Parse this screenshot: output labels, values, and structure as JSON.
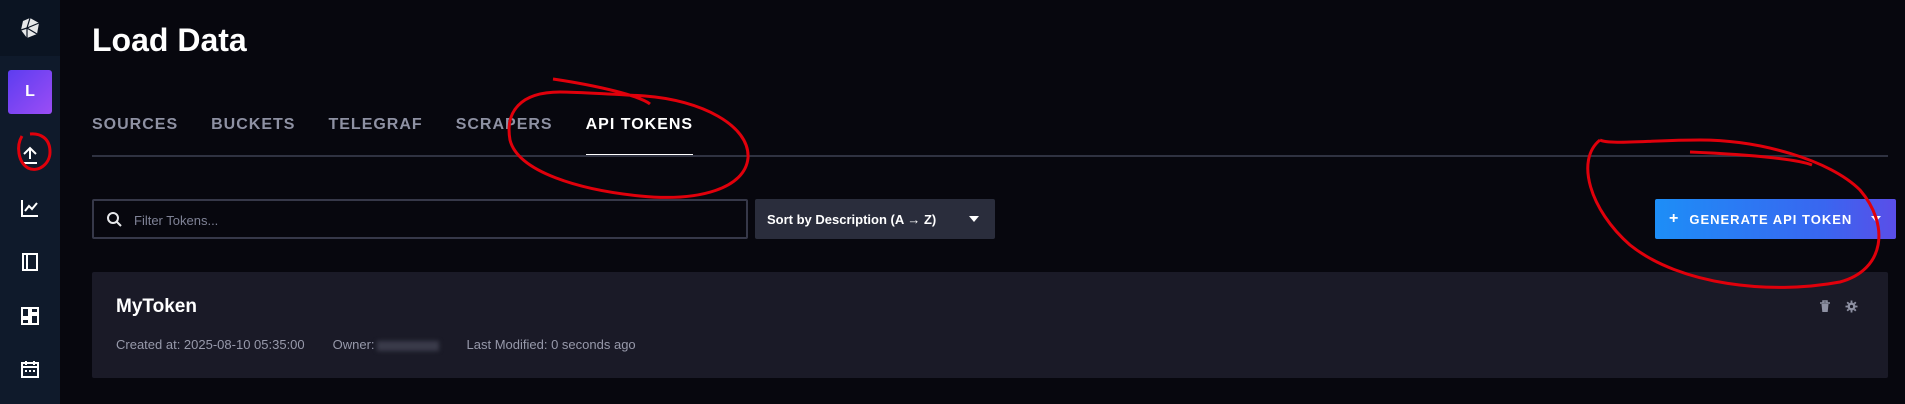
{
  "page": {
    "title": "Load Data"
  },
  "sidebar": {
    "avatar_letter": "L",
    "items": [
      {
        "icon": "upload-icon",
        "label": "Load Data"
      },
      {
        "icon": "chart-icon",
        "label": "Data Explorer"
      },
      {
        "icon": "notebook-icon",
        "label": "Notebooks"
      },
      {
        "icon": "dashboard-icon",
        "label": "Dashboards"
      },
      {
        "icon": "calendar-icon",
        "label": "Tasks"
      }
    ]
  },
  "tabs": [
    {
      "label": "SOURCES",
      "active": false
    },
    {
      "label": "BUCKETS",
      "active": false
    },
    {
      "label": "TELEGRAF",
      "active": false
    },
    {
      "label": "SCRAPERS",
      "active": false
    },
    {
      "label": "API TOKENS",
      "active": true
    }
  ],
  "filter": {
    "placeholder": "Filter Tokens..."
  },
  "sort": {
    "label": "Sort by Description (A → Z)"
  },
  "generate_button": {
    "label": "GENERATE API TOKEN",
    "plus": "+"
  },
  "tokens": [
    {
      "name": "MyToken",
      "created": "Created at: 2025-08-10 05:35:00",
      "owner": "Owner:",
      "modified": "Last Modified: 0 seconds ago"
    }
  ],
  "colors": {
    "background": "#07070e",
    "sidebar": "#0f1a2b",
    "card": "#1a1a27",
    "accent_blue": "#1d8ef7",
    "annotation_red": "#e0000b"
  }
}
